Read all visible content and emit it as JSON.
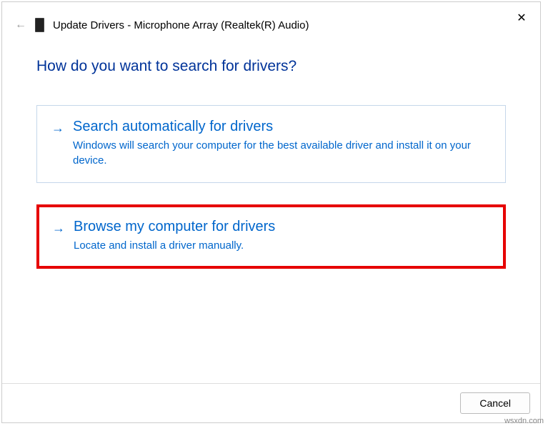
{
  "header": {
    "title": "Update Drivers - Microphone Array (Realtek(R) Audio)"
  },
  "question": "How do you want to search for drivers?",
  "options": [
    {
      "title": "Search automatically for drivers",
      "description": "Windows will search your computer for the best available driver and install it on your device."
    },
    {
      "title": "Browse my computer for drivers",
      "description": "Locate and install a driver manually."
    }
  ],
  "footer": {
    "cancel_label": "Cancel"
  },
  "watermark": "wsxdn.com"
}
